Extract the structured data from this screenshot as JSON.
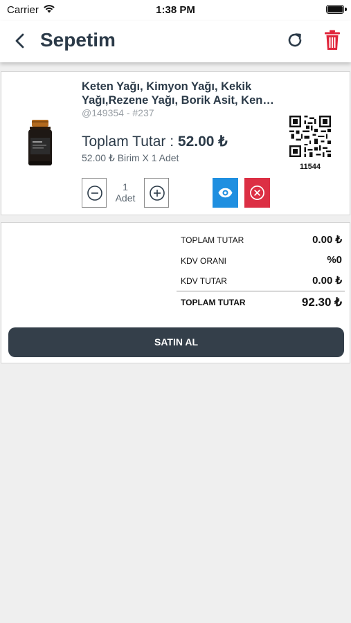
{
  "status_bar": {
    "carrier": "Carrier",
    "time": "1:38 PM"
  },
  "nav": {
    "title": "Sepetim",
    "icons": [
      "back-chevron-icon",
      "refresh-icon",
      "trash-icon"
    ],
    "delete_color": "#e0243a"
  },
  "cart": {
    "items": [
      {
        "name": "Keten Yağı, Kimyon Yağı, Kekik Yağı,Rezene Yağı, Borik Asit, Ken…",
        "code": "@149354 - #237",
        "total_label": "Toplam Tutar : ",
        "total_value": "52.00 ₺",
        "unit_line": "52.00 ₺ Birim X 1 Adet",
        "qr_id": "11544",
        "quantity": "1",
        "quantity_unit": "Adet",
        "view_color": "#1f8fe0",
        "remove_color": "#dc2f44"
      }
    ]
  },
  "summary": {
    "rows": [
      {
        "label": "TOPLAM TUTAR",
        "value": "0.00 ₺"
      },
      {
        "label": "KDV ORANI",
        "value": "%0"
      },
      {
        "label": "KDV TUTAR",
        "value": "0.00 ₺"
      }
    ],
    "grand_total": {
      "label": "TOPLAM TUTAR",
      "value": "92.30 ₺"
    },
    "buy_label": "SATIN AL"
  },
  "colors": {
    "accent_dark": "#343f4a",
    "title_text": "#2b3a48"
  }
}
